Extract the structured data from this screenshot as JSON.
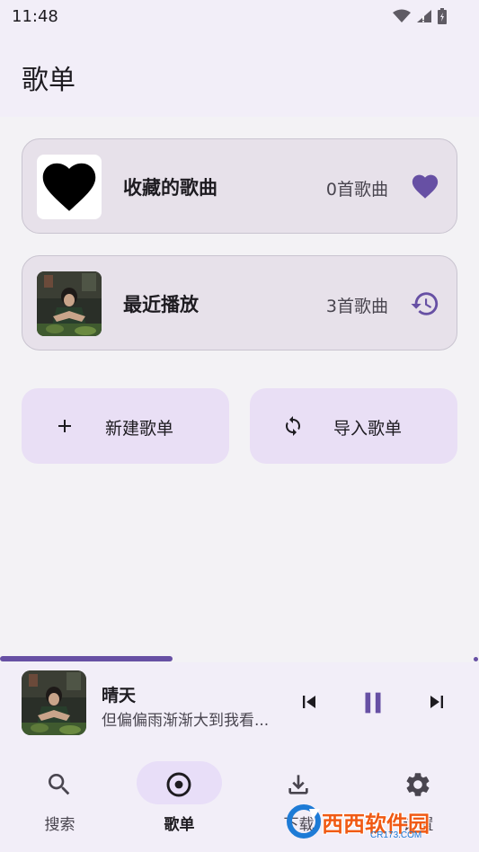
{
  "status_bar": {
    "time": "11:48"
  },
  "page": {
    "title": "歌单"
  },
  "playlists": [
    {
      "title": "收藏的歌曲",
      "count": "0首歌曲",
      "icon": "heart-icon"
    },
    {
      "title": "最近播放",
      "count": "3首歌曲",
      "icon": "history-icon"
    }
  ],
  "actions": {
    "new_label": "新建歌单",
    "import_label": "导入歌单"
  },
  "player": {
    "progress": 0.36,
    "title": "晴天",
    "lyric": "但偏偏雨渐渐大到我看..."
  },
  "nav": {
    "items": [
      {
        "label": "搜索",
        "icon": "search-icon"
      },
      {
        "label": "歌单",
        "icon": "album-icon",
        "active": true
      },
      {
        "label": "下载",
        "icon": "download-icon"
      },
      {
        "label": "设置",
        "icon": "gear-icon"
      }
    ]
  },
  "watermark": {
    "brand": "西西软件园",
    "url": "CR173.COM"
  },
  "colors": {
    "accent": "#6750a4",
    "surface": "#f2eef8",
    "card": "#e7e1ea",
    "tonal_button": "#e9dff5"
  }
}
